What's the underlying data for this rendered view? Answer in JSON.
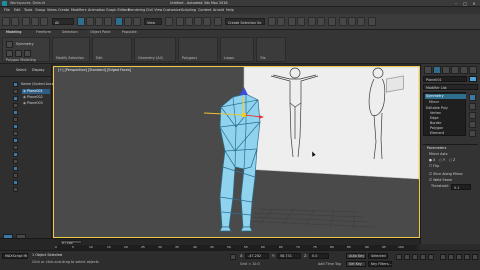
{
  "window": {
    "title": "Untitled - Autodesk 3ds Max 2018",
    "workspace": "Workspaces: Default"
  },
  "menu": [
    "File",
    "Edit",
    "Tools",
    "Group",
    "Views",
    "Create",
    "Modifiers",
    "Animation",
    "Graph Editors",
    "Rendering",
    "Civil View",
    "Customize",
    "Scripting",
    "Content",
    "Arnold",
    "Help"
  ],
  "toolbar": {
    "selection_filter": "All",
    "selection_set": "Create Selection Se",
    "view": "View"
  },
  "ribbon": {
    "tabs": [
      "Modeling",
      "Freeform",
      "Selection",
      "Object Paint",
      "Populate"
    ],
    "active_tab": "Modeling",
    "panels": [
      "Polygon Modeling",
      "Modify Selection",
      "Edit",
      "Geometry (All)",
      "Polygons",
      "Loops",
      "Tris"
    ],
    "symmetry_label": "Symmetry",
    "polygon_modeling_label": "Polygon Modeling"
  },
  "explorer": {
    "tabs": [
      "Select",
      "Display"
    ],
    "header": "Name (Sorted Ascending)",
    "items": [
      "Plane001",
      "Plane002",
      "Plane003"
    ]
  },
  "viewport": {
    "label": "[+] [Perspective] [Standard] [Edged Faces]"
  },
  "command_panel": {
    "object_name": "Plane001",
    "modifier_list_label": "Modifier List",
    "stack": [
      "Symmetry",
      "Mirror",
      "Editable Poly",
      "Vertex",
      "Edge",
      "Border",
      "Polygon",
      "Element"
    ],
    "section_title": "Parameters",
    "mirror_axis_label": "Mirror Axis:",
    "axes": [
      "X",
      "Y",
      "Z"
    ],
    "flip_label": "Flip",
    "slice_label": "Slice Along Mirror",
    "weld_label": "Weld Seam",
    "threshold_label": "Threshold:",
    "threshold_value": "0.1"
  },
  "timeline": {
    "frame_indicator": "0 / 100",
    "ticks": [
      "0",
      "5",
      "10",
      "15",
      "20",
      "25",
      "30",
      "35",
      "40",
      "45",
      "50",
      "55",
      "60",
      "65",
      "70",
      "75",
      "80",
      "85",
      "90",
      "95",
      "100"
    ]
  },
  "status": {
    "line1": "1 Object Selected",
    "line2": "Click or click-and-drag to select objects",
    "maxscript": "MAXScript Mi",
    "x_label": "X:",
    "x_value": "-47.202",
    "y_label": "Y:",
    "y_value": "58.731",
    "z_label": "Z:",
    "z_value": "0.0",
    "grid": "Grid = 10.0",
    "auto_key": "Auto Key",
    "set_key": "Set Key",
    "key_filters": "Key Filters...",
    "add_time_tag": "Add Time Tag",
    "selected": "Selected"
  },
  "colors": {
    "accent": "#2f6f8e",
    "viewport_border": "#f0c94a",
    "model": "#8fd3ef",
    "model_edge": "#2c6e8e"
  }
}
